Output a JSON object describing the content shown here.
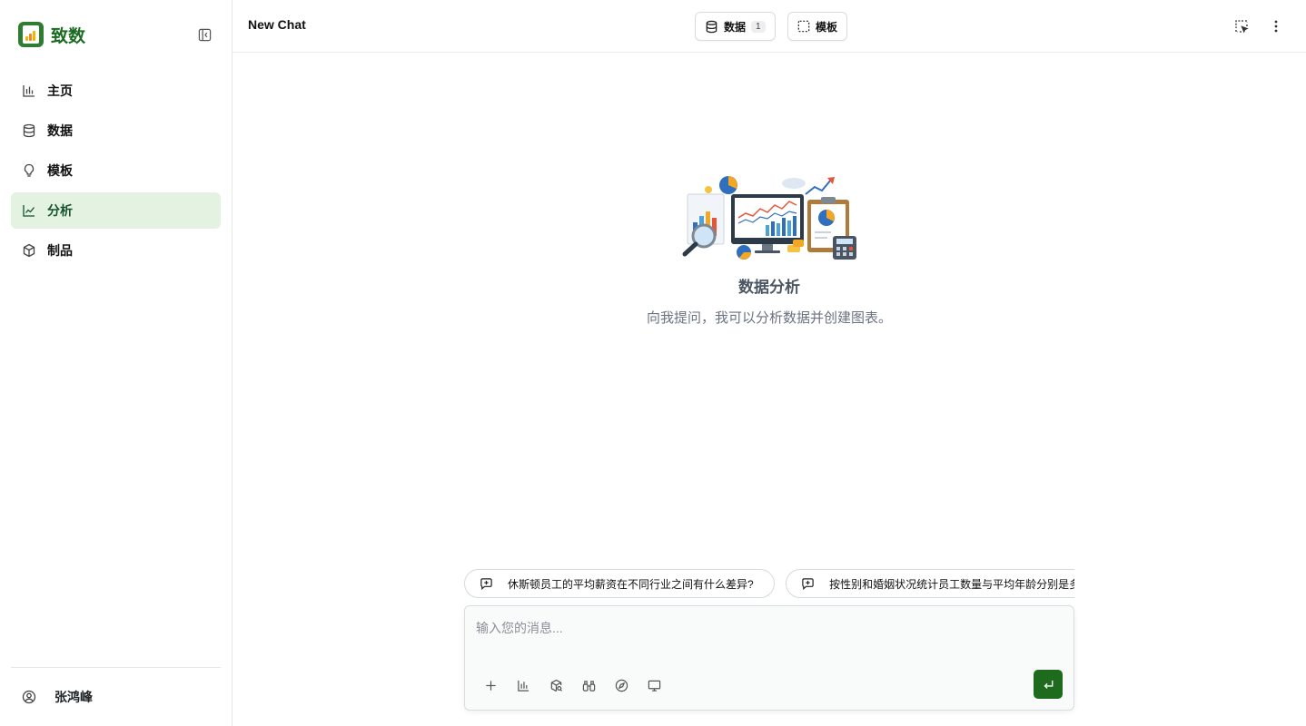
{
  "brand": {
    "name": "致数",
    "color": "#1b6b23"
  },
  "sidebar": {
    "items": [
      {
        "label": "主页",
        "icon": "bar-chart-icon"
      },
      {
        "label": "数据",
        "icon": "database-icon"
      },
      {
        "label": "模板",
        "icon": "lightbulb-icon"
      },
      {
        "label": "分析",
        "icon": "line-chart-icon",
        "active": true
      },
      {
        "label": "制品",
        "icon": "box-icon"
      }
    ],
    "user": {
      "name": "张鸿峰",
      "icon": "user-circle-icon"
    }
  },
  "header": {
    "title": "New Chat",
    "data_button": {
      "label": "数据",
      "count": "1"
    },
    "template_button": {
      "label": "模板"
    }
  },
  "hero": {
    "title": "数据分析",
    "subtitle": "向我提问，我可以分析数据并创建图表。"
  },
  "suggestions": [
    "休斯顿员工的平均薪资在不同行业之间有什么差异?",
    "按性别和婚姻状况统计员工数量与平均年龄分别是多少?"
  ],
  "composer": {
    "placeholder": "输入您的消息...",
    "tools": [
      "plus-icon",
      "chart-icon",
      "package-search-icon",
      "binoculars-icon",
      "compass-icon",
      "monitor-icon"
    ],
    "send_icon": "enter-icon"
  },
  "colors": {
    "accent": "#1e6b1e",
    "active_bg": "#e3f2e1"
  }
}
